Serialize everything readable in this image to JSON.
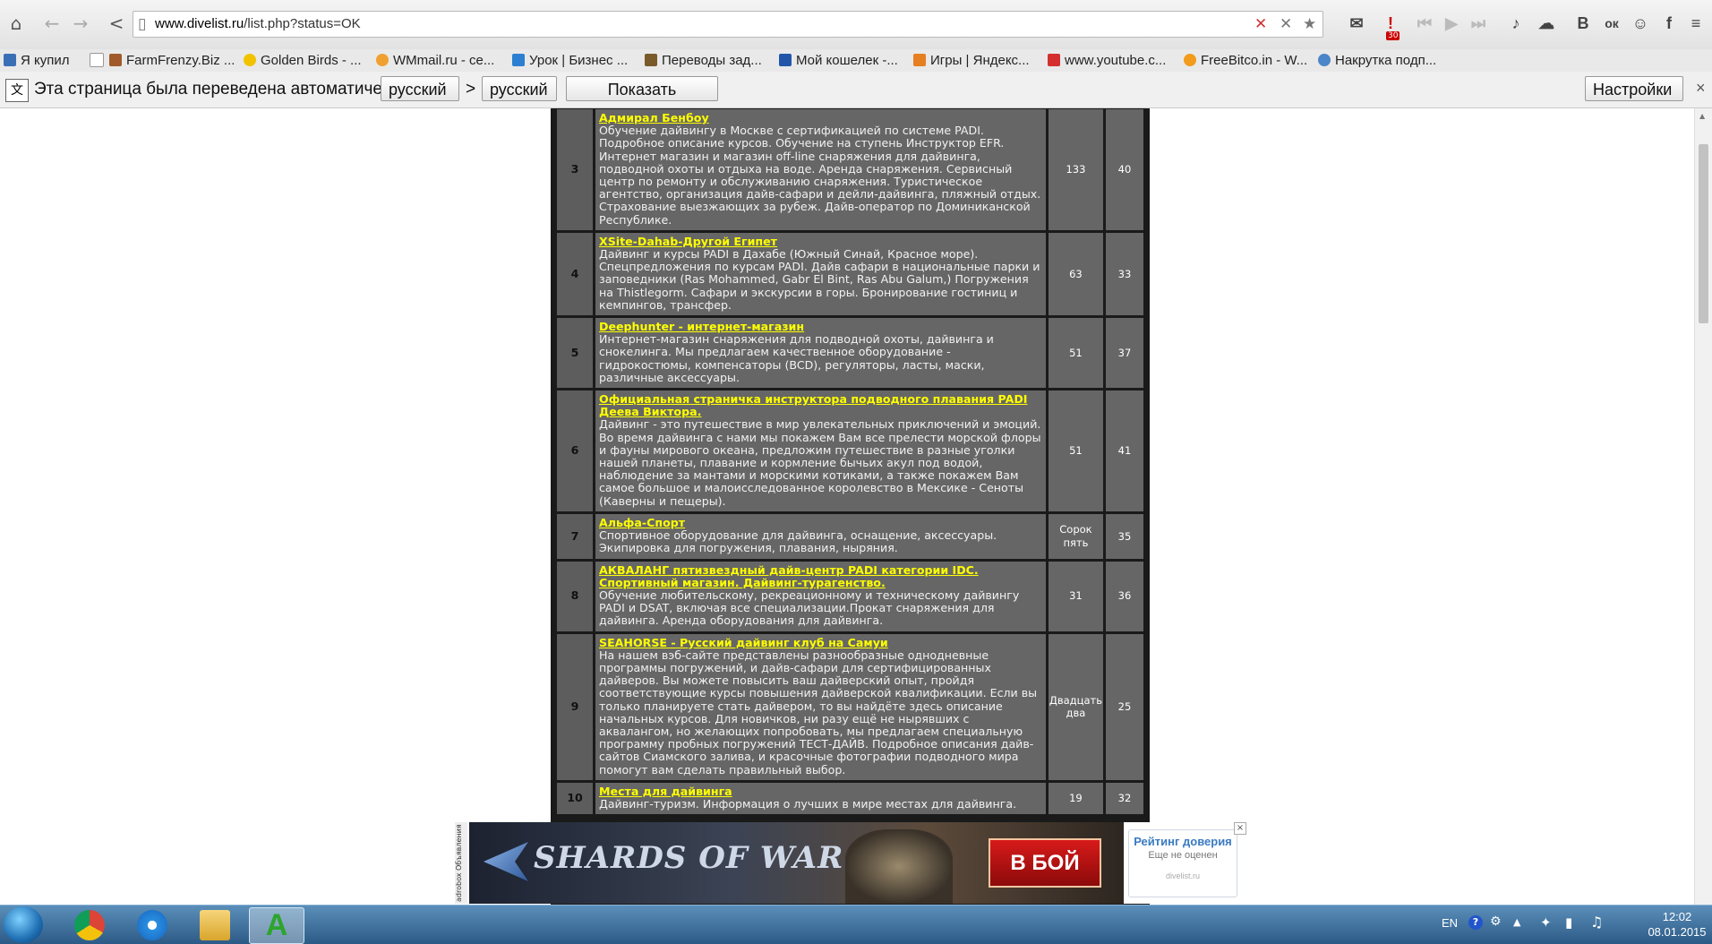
{
  "browser": {
    "url_host": "www.divelist.ru",
    "url_path": "/list.php?status=OK",
    "mail_badge": "30",
    "right_icons": [
      "В",
      "ок",
      "f"
    ]
  },
  "bookmarks": [
    {
      "label": "Я купил",
      "color": "#3a6fb5"
    },
    {
      "label": "FarmFrenzy.Biz ...",
      "color": "#a05a2c"
    },
    {
      "label": "Golden Birds - ...",
      "color": "#f2c200"
    },
    {
      "label": "WMmail.ru - се...",
      "color": "#f0a030"
    },
    {
      "label": "Урок | Бизнес ...",
      "color": "#2c7fd1"
    },
    {
      "label": "Переводы зад...",
      "color": "#7a5a2a"
    },
    {
      "label": "Мой кошелек -...",
      "color": "#2255aa"
    },
    {
      "label": "Игры | Яндекс...",
      "color": "#e67e22"
    },
    {
      "label": "www.youtube.c...",
      "color": "#d32f2f"
    },
    {
      "label": "FreeBitco.in - W...",
      "color": "#f29b1d"
    },
    {
      "label": "Накрутка подп...",
      "color": "#4a86c8"
    }
  ],
  "translate": {
    "message": "Эта страница была переведена автоматически",
    "from_lang": "русский",
    "arrow": ">",
    "to_lang": "русский",
    "show_original": "Показать оригинал",
    "settings": "Настройки",
    "close": "×"
  },
  "rows": [
    {
      "num": "3",
      "title": "Адмирал Бенбоу",
      "desc": "Обучение дайвингу в Москве с сертификацией по системе PADI. Подробное описание курсов. Обучение на ступень Инструктор EFR. Интернет магазин и магазин off-line снаряжения для дайвинга, подводной охоты и отдыха на воде. Аренда снаряжения. Сервисный центр по ремонту и обслуживанию снаряжения. Туристическое агентство, организация дайв-сафари и дейли-дайвинга, пляжный отдых. Страхование выезжающих за рубеж. Дайв-оператор по Доминиканской Республике.",
      "stat1": "133",
      "stat2": "40"
    },
    {
      "num": "4",
      "title": "XSite-Dahab-Другой Египет",
      "desc": "Дайвинг и курсы PADI в Дахабе (Южный Синай, Красное море). Спецпредложения по курсам PADI. Дайв сафари в национальные парки и заповедники (Ras Mohammed, Gabr El Bint, Ras Abu Galum,) Погружения на Thistlegorm. Сафари и экскурсии в горы. Бронирование гостиниц и кемпингов, трансфер.",
      "stat1": "63",
      "stat2": "33"
    },
    {
      "num": "5",
      "title": "Deephunter - интернет-магазин",
      "desc": "Интернет-магазин снаряжения для подводной охоты, дайвинга и снокелинга. Мы предлагаем качественное оборудование - гидрокостюмы, компенсаторы (BCD), регуляторы, ласты, маски, различные аксессуары.",
      "stat1": "51",
      "stat2": "37"
    },
    {
      "num": "6",
      "title": "Официальная страничка инструктора подводного плавания PADI Деева Виктора.",
      "desc": "Дайвинг - это путешествие в мир увлекательных приключений и эмоций. Во время дайвинга с нами мы покажем Вам все прелести морской флоры и фауны мирового океана, предложим путешествие в разные уголки нашей планеты, плавание и кормление бычьих акул под водой, наблюдение за мантами и морскими котиками, а также покажем Вам самое большое и малоисследованное королевство в Мексике - Сеноты (Каверны и пещеры).",
      "stat1": "51",
      "stat2": "41"
    },
    {
      "num": "7",
      "title": "Альфа-Спорт",
      "desc": "Спортивное оборудование для дайвинга, оснащение, аксессуары. Экипировка для погружения, плавания, ныряния.",
      "stat1": "Сорок пять",
      "stat2": "35"
    },
    {
      "num": "8",
      "title": "АКВАЛАНГ пятизвездный дайв-центр PADI категории IDC. Спортивный магазин. Дайвинг-турагенство.",
      "desc": "Обучение любительскому, рекреационному и техническому дайвингу PADI и DSAT, включая все специализации.Прокат снаряжения для дайвинга. Аренда оборудования для дайвинга.",
      "stat1": "31",
      "stat2": "36"
    },
    {
      "num": "9",
      "title": "SEAHORSE - Русский дайвинг клуб на Самуи",
      "desc": "На нашем вэб-сайте представлены разнообразные однодневные программы погружений, и дайв-сафари для сертифицированных дайверов. Вы можете повысить ваш дайверский опыт, пройдя соответствующие курсы повышения дайверской квалификации. Если вы только планируете стать дайвером, то вы найдёте здесь описание начальных курсов. Для новичков, ни разу ещё не нырявших с аквалангом, но желающих попробовать, мы предлагаем специальную программу пробных погружений ТЕСТ-ДАЙВ. Подробное описания дайв-сайтов Сиамского залива, и красочные фотографии подводного мира помогут вам сделать правильный выбор.",
      "stat1": "Двадцать два",
      "stat2": "25"
    },
    {
      "num": "10",
      "title": "Места для дайвинга",
      "desc": "Дайвинг-туризм. Информация о лучших в мире местах для дайвинга.",
      "stat1": "19",
      "stat2": "32"
    }
  ],
  "banner": {
    "side_text": "adrobox Объявления",
    "logo": "SHARDS OF WAR",
    "button": "В БОЙ",
    "rating_title": "Рейтинг доверия",
    "rating_sub": "Еще не оценен",
    "rating_site": "divelist.ru",
    "close": "×"
  },
  "taskbar": {
    "lang": "EN",
    "time": "12:02",
    "date": "08.01.2015"
  }
}
